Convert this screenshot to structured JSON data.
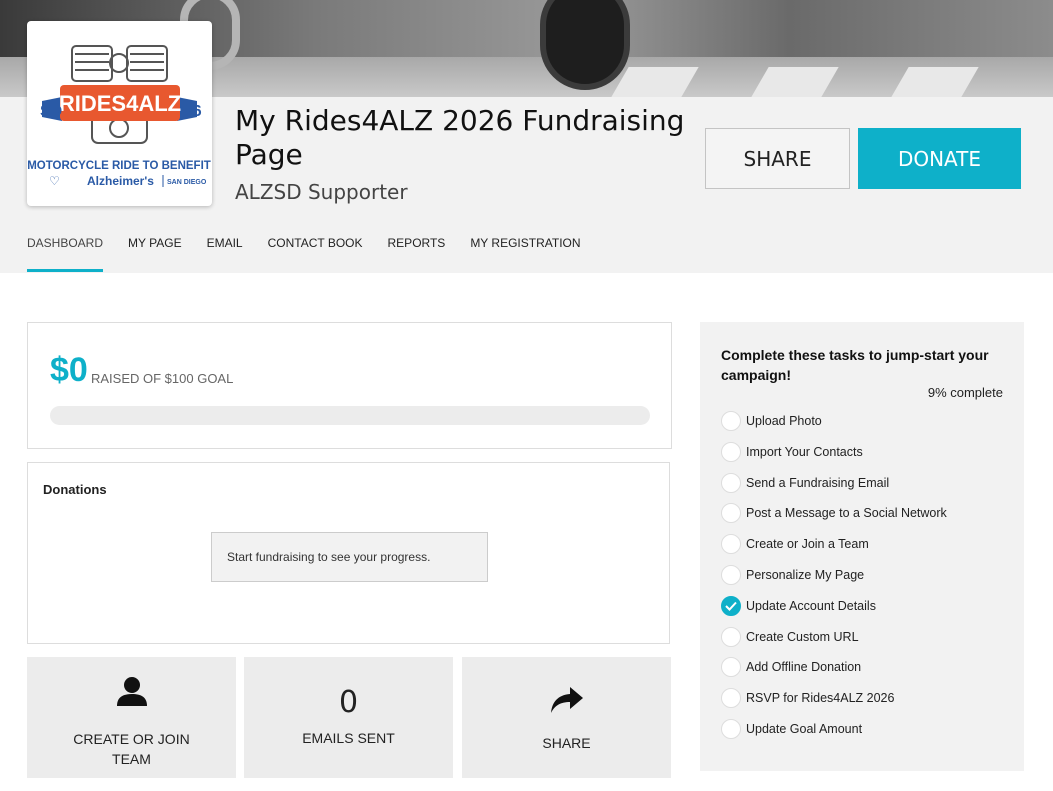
{
  "banner": {
    "logo": {
      "sd": "SD",
      "name": "RIDES4ALZ",
      "year": "'26",
      "tagline": "MOTORCYCLE RIDE TO BENEFIT",
      "org": "Alzheimer's",
      "city": "SAN DIEGO"
    }
  },
  "header": {
    "title": "My Rides4ALZ 2026 Fundraising Page",
    "subtitle": "ALZSD Supporter",
    "share_label": "SHARE",
    "donate_label": "DONATE"
  },
  "tabs": [
    {
      "label": "DASHBOARD",
      "active": true
    },
    {
      "label": "MY PAGE"
    },
    {
      "label": "EMAIL"
    },
    {
      "label": "CONTACT BOOK"
    },
    {
      "label": "REPORTS"
    },
    {
      "label": "MY REGISTRATION"
    }
  ],
  "progress": {
    "raised": "$0",
    "goal_text": "RAISED OF $100 GOAL",
    "fraction": 0
  },
  "donations": {
    "title": "Donations",
    "empty_message": "Start fundraising to see your progress."
  },
  "tiles": {
    "team_label": "CREATE OR JOIN TEAM",
    "emails_count": "0",
    "emails_label": "EMAILS SENT",
    "share_label": "SHARE"
  },
  "tasks": {
    "title": "Complete these tasks to jump-start your campaign!",
    "percent": "9% complete",
    "items": [
      {
        "label": "Upload Photo",
        "done": false
      },
      {
        "label": "Import Your Contacts",
        "done": false
      },
      {
        "label": "Send a Fundraising Email",
        "done": false
      },
      {
        "label": "Post a Message to a Social Network",
        "done": false
      },
      {
        "label": "Create or Join a Team",
        "done": false
      },
      {
        "label": "Personalize My Page",
        "done": false
      },
      {
        "label": "Update Account Details",
        "done": true
      },
      {
        "label": "Create Custom URL",
        "done": false
      },
      {
        "label": "Add Offline Donation",
        "done": false
      },
      {
        "label": "RSVP for Rides4ALZ 2026",
        "done": false
      },
      {
        "label": "Update Goal Amount",
        "done": false
      }
    ]
  },
  "colors": {
    "accent": "#0eb0c9",
    "logo_orange": "#e8582f",
    "logo_blue": "#2a5aa6"
  },
  "icons": {
    "team": "person-icon",
    "share": "share-arrow-icon",
    "task_done": "checkmark-icon"
  }
}
